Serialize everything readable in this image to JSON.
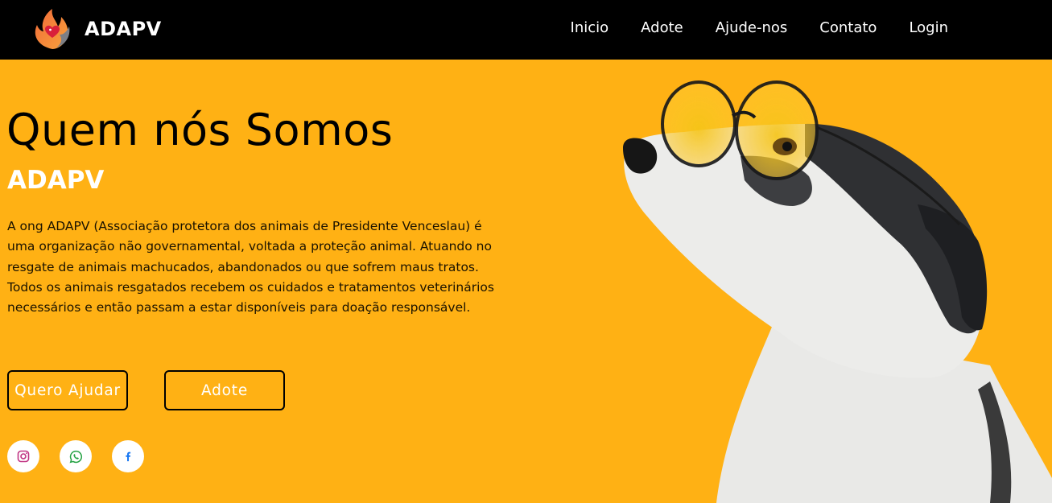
{
  "brand": {
    "name": "ADAPV"
  },
  "nav": {
    "items": [
      "Inicio",
      "Adote",
      "Ajude-nos",
      "Contato",
      "Login"
    ]
  },
  "hero": {
    "title": "Quem nós Somos",
    "subtitle": "ADAPV",
    "text": "A ong ADAPV (Associação protetora dos animais de Presidente Venceslau) é uma organização não governamental, voltada a proteção animal. Atuando no resgate de animais machucados, abandonados ou que sofrem maus tratos. Todos os animais resgatados recebem os cuidados e tratamentos veterinários necessários e então passam a estar disponíveis para doação responsável.",
    "buttons": {
      "help": "Quero Ajudar",
      "adopt": "Adote"
    }
  },
  "social": [
    {
      "icon": "instagram-icon",
      "color": "#c13584"
    },
    {
      "icon": "whatsapp-icon",
      "color": "#25a244"
    },
    {
      "icon": "facebook-icon",
      "color": "#1877f2"
    }
  ],
  "colors": {
    "background": "#ffb114",
    "navbar": "#000000",
    "lens": "#f5c518"
  }
}
